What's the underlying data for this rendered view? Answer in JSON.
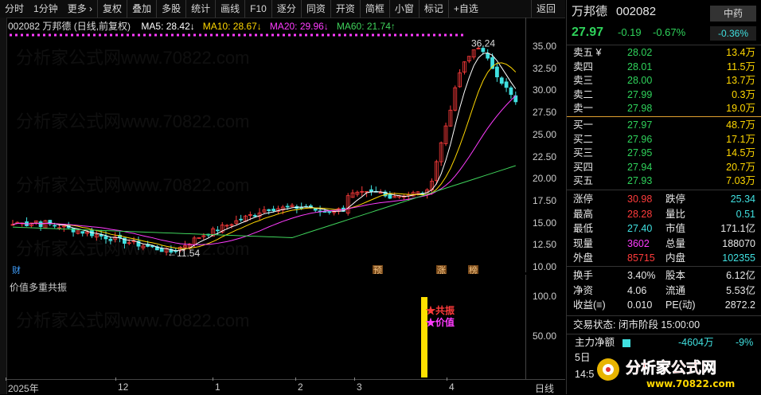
{
  "toolbar": {
    "items": [
      "分时",
      "1分钟",
      "更多 ›",
      "复权",
      "叠加",
      "多股",
      "统计",
      "画线",
      "F10",
      "逐分",
      "同资",
      "开资",
      "简框",
      "小窗",
      "标记",
      "+自选",
      "返回"
    ]
  },
  "chart": {
    "symbol_label": "002082 万邦德 (日线,前复权)",
    "ma": [
      {
        "label": "MA5: 28.42↓",
        "color": "#ffffff"
      },
      {
        "label": "MA10: 28.67↓",
        "color": "#ffd700"
      },
      {
        "label": "MA20: 29.96↓",
        "color": "#ff3cff"
      },
      {
        "label": "MA60: 21.74↑",
        "color": "#3fd35b"
      }
    ],
    "y_ticks": [
      "35.00",
      "32.50",
      "30.00",
      "27.50",
      "25.00",
      "22.50",
      "20.00",
      "17.50",
      "15.00",
      "12.50",
      "10.00"
    ],
    "high_label": "36.24",
    "low_label": "←11.54",
    "markers": [
      "财",
      "预",
      "涨",
      "榜"
    ]
  },
  "indicator": {
    "title": "价值多重共振",
    "y_ticks": [
      "100.0",
      "50.00"
    ],
    "labels": [
      "★共振",
      "★价值"
    ],
    "value": 100
  },
  "x_axis": {
    "ticks": [
      "2025年",
      "12",
      "1",
      "2",
      "3",
      "4"
    ],
    "period_label": "日线"
  },
  "quote": {
    "name": "万邦德",
    "code": "002082",
    "sector": "中药",
    "sector_change": "-0.36%",
    "price": "27.97",
    "change": "-0.19",
    "change_pct": "-0.67%",
    "asks": [
      {
        "label": "卖五 ¥",
        "price": "28.02",
        "vol": "13.4万"
      },
      {
        "label": "卖四",
        "price": "28.01",
        "vol": "11.5万"
      },
      {
        "label": "卖三",
        "price": "28.00",
        "vol": "13.7万"
      },
      {
        "label": "卖二",
        "price": "27.99",
        "vol": "0.3万"
      },
      {
        "label": "卖一",
        "price": "27.98",
        "vol": "19.0万"
      }
    ],
    "bids": [
      {
        "label": "买一",
        "price": "27.97",
        "vol": "48.7万"
      },
      {
        "label": "买二",
        "price": "27.96",
        "vol": "17.1万"
      },
      {
        "label": "买三",
        "price": "27.95",
        "vol": "14.5万"
      },
      {
        "label": "买四",
        "price": "27.94",
        "vol": "20.7万"
      },
      {
        "label": "买五",
        "price": "27.93",
        "vol": "7.03万"
      }
    ],
    "stats": [
      {
        "k1": "涨停",
        "v1": "30.98",
        "c1": "red",
        "k2": "跌停",
        "v2": "25.34",
        "c2": "cyan"
      },
      {
        "k1": "最高",
        "v1": "28.28",
        "c1": "red",
        "k2": "量比",
        "v2": "0.51",
        "c2": "cyan"
      },
      {
        "k1": "最低",
        "v1": "27.40",
        "c1": "cyan",
        "k2": "市值",
        "v2": "171.1亿",
        "c2": "white"
      },
      {
        "k1": "现量",
        "v1": "3602",
        "c1": "magenta",
        "k2": "总量",
        "v2": "188070",
        "c2": "white"
      },
      {
        "k1": "外盘",
        "v1": "85715",
        "c1": "red",
        "k2": "内盘",
        "v2": "102355",
        "c2": "cyan"
      }
    ],
    "stats2": [
      {
        "k1": "换手",
        "v1": "3.40%",
        "k2": "股本",
        "v2": "6.12亿"
      },
      {
        "k1": "净资",
        "v1": "4.06",
        "k2": "流通",
        "v2": "5.53亿"
      },
      {
        "k1": "收益(≡)",
        "v1": "0.010",
        "k2": "PE(动)",
        "v2": "2872.2"
      }
    ],
    "trade_status": "交易状态: 闭市阶段 15:00:00",
    "main_flow_label": "主力净额",
    "main_flow_value": "-4604万",
    "main_flow_pct": "-9%",
    "extra_1": "5日",
    "extra_2": "14:5"
  },
  "logo": {
    "text": "分析家公式网",
    "url": "www.70822.com"
  },
  "watermark": "分析家公式网www.70822.com"
}
